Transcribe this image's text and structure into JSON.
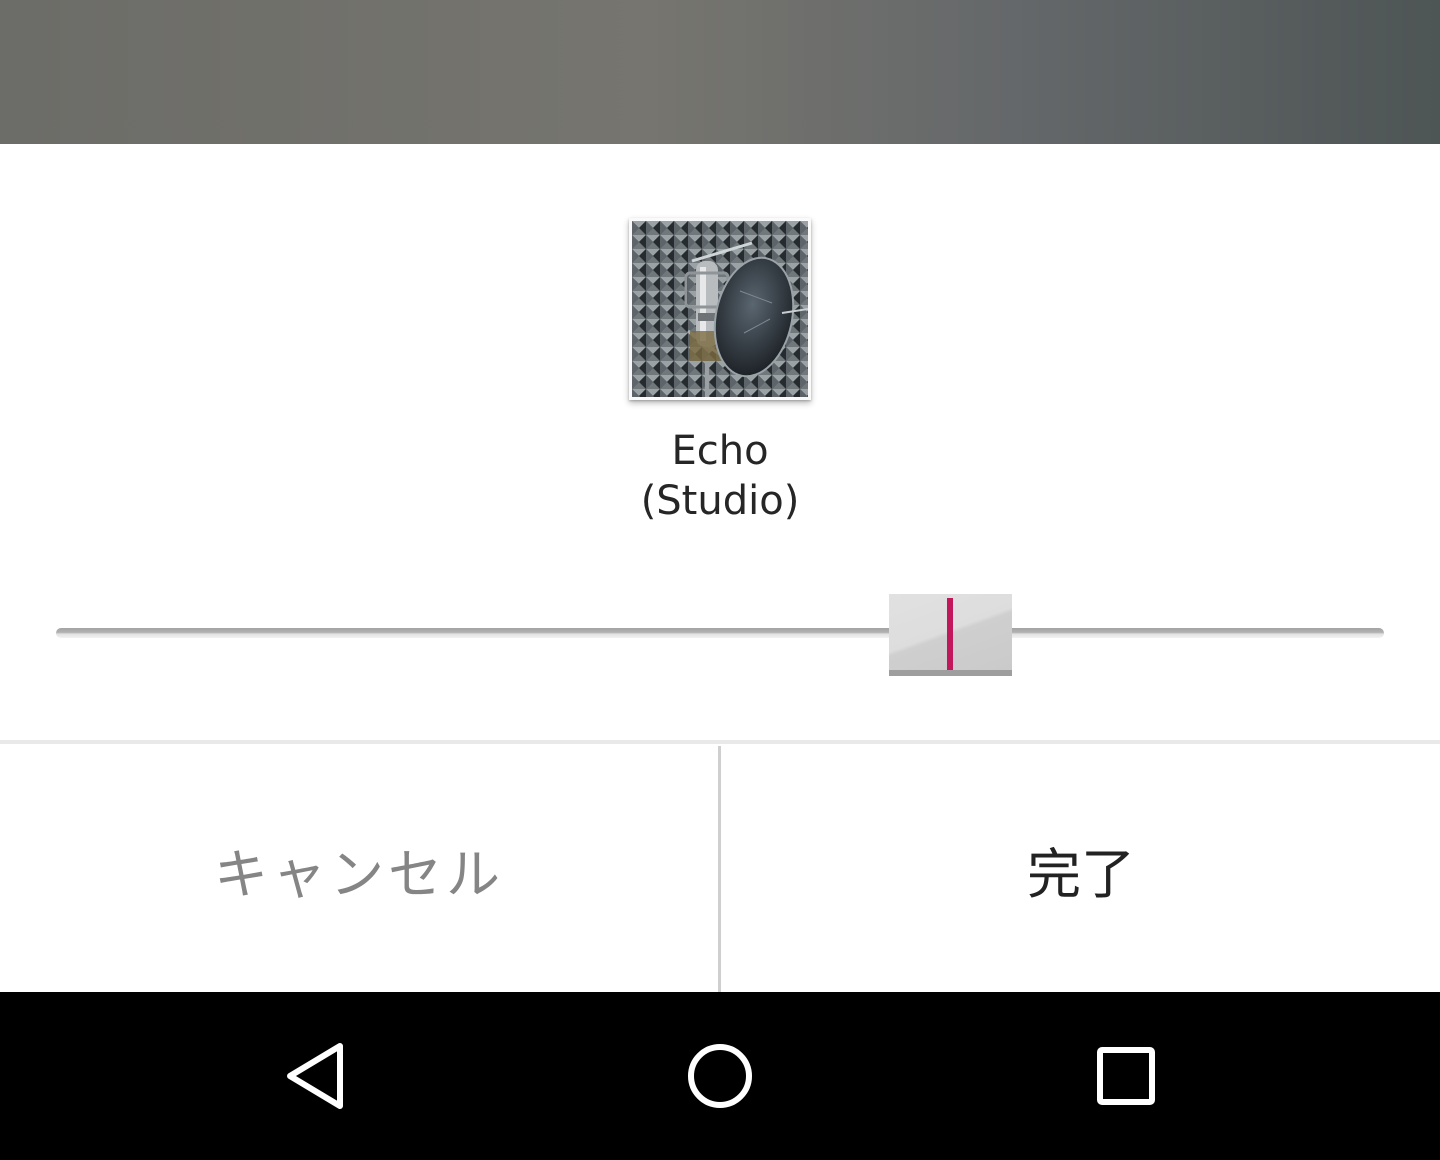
{
  "effect": {
    "name_line1": "Echo",
    "name_line2": "(Studio)",
    "thumbnail_icon": "studio-microphone-image"
  },
  "slider": {
    "value_fraction": 0.673,
    "accent_color": "#c2185b"
  },
  "actions": {
    "cancel_label": "キャンセル",
    "done_label": "完了"
  },
  "navbar": {
    "back_icon": "back-triangle-icon",
    "home_icon": "home-circle-icon",
    "recents_icon": "recents-square-icon"
  }
}
